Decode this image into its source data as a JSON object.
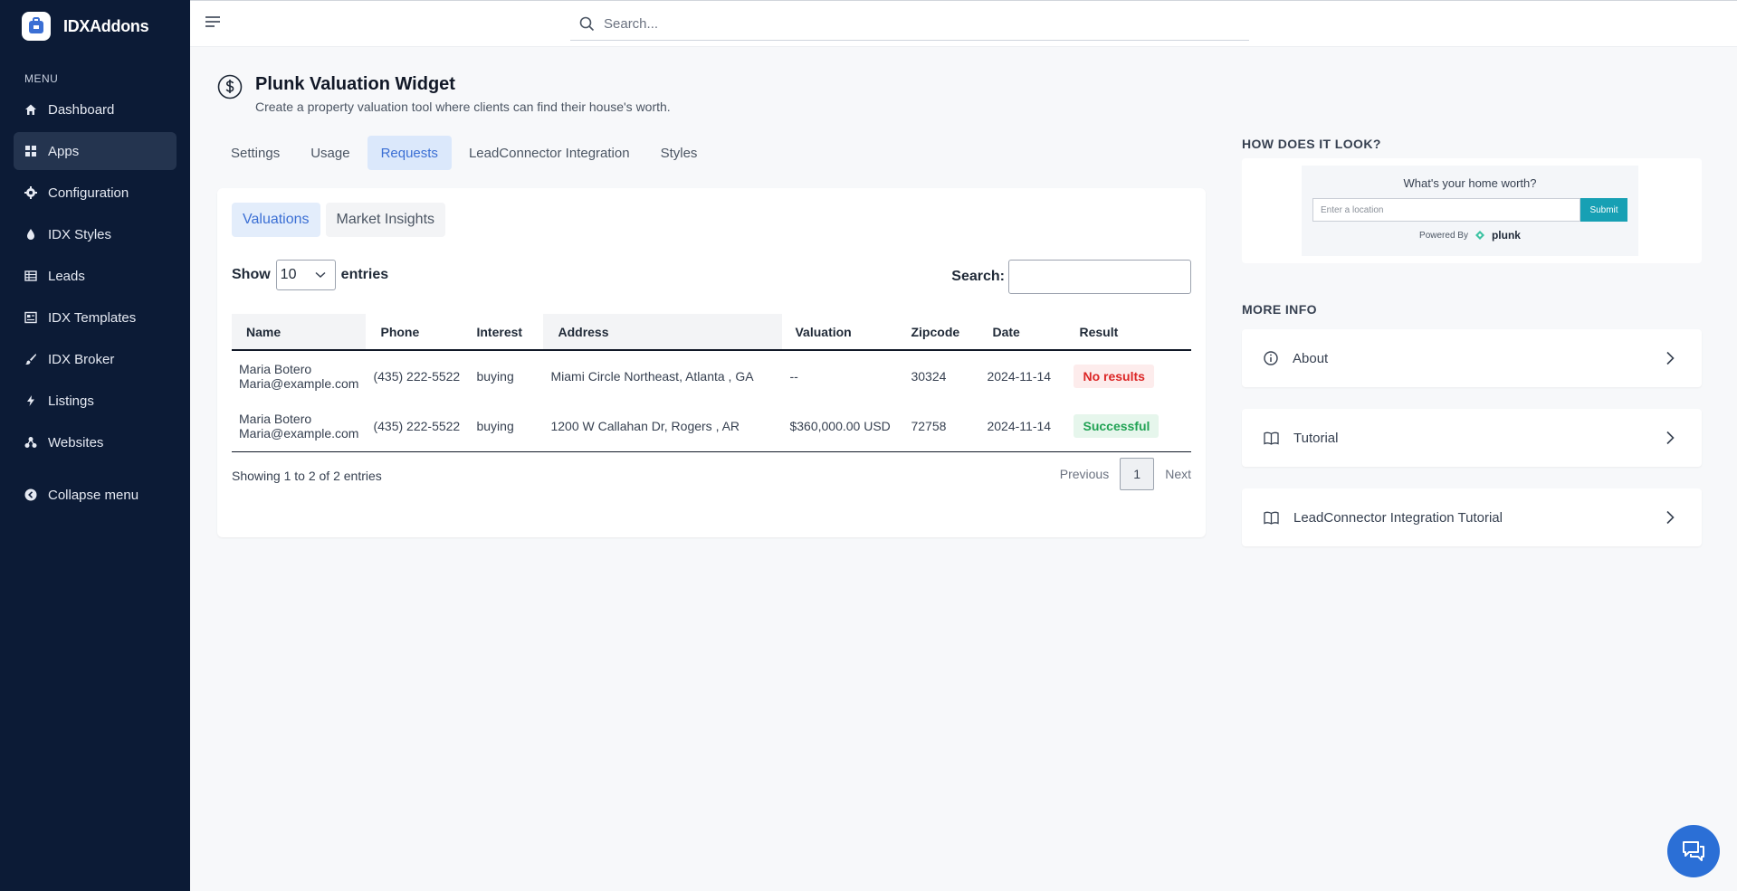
{
  "brand": {
    "name": "IDXAddons"
  },
  "sidebar": {
    "caption": "MENU",
    "items": [
      {
        "label": "Dashboard",
        "icon": "home-icon"
      },
      {
        "label": "Apps",
        "icon": "grid-icon",
        "active": true
      },
      {
        "label": "Configuration",
        "icon": "gear-icon"
      },
      {
        "label": "IDX Styles",
        "icon": "droplet-icon"
      },
      {
        "label": "Leads",
        "icon": "table-icon"
      },
      {
        "label": "IDX Templates",
        "icon": "template-icon"
      },
      {
        "label": "IDX Broker",
        "icon": "brush-icon"
      },
      {
        "label": "Listings",
        "icon": "bolt-icon"
      },
      {
        "label": "Websites",
        "icon": "network-icon"
      }
    ],
    "collapse_label": "Collapse menu"
  },
  "topbar": {
    "search_placeholder": "Search..."
  },
  "page": {
    "title": "Plunk Valuation Widget",
    "subtitle": "Create a property valuation tool where clients can find their house's worth."
  },
  "tabs": [
    "Settings",
    "Usage",
    "Requests",
    "LeadConnector Integration",
    "Styles"
  ],
  "active_tab": "Requests",
  "subtabs": [
    "Valuations",
    "Market Insights"
  ],
  "table": {
    "show_label": "Show",
    "entries_label": "entries",
    "page_length": "10",
    "search_label": "Search:",
    "columns": [
      "Name",
      "Phone",
      "Interest",
      "Address",
      "Valuation",
      "Zipcode",
      "Date",
      "Result"
    ],
    "rows": [
      {
        "name": "Maria Botero",
        "email": "Maria@example.com",
        "phone": "(435) 222-5522",
        "interest": "buying",
        "address": "Miami Circle Northeast, Atlanta , GA",
        "valuation": "--",
        "zipcode": "30324",
        "date": "2024-11-14",
        "result": "No results"
      },
      {
        "name": "Maria Botero",
        "email": "Maria@example.com",
        "phone": "(435) 222-5522",
        "interest": "buying",
        "address": "1200 W Callahan Dr, Rogers , AR",
        "valuation": "$360,000.00 USD",
        "zipcode": "72758",
        "date": "2024-11-14",
        "result": "Successful"
      }
    ],
    "info": "Showing 1 to 2 of 2 entries",
    "previous_label": "Previous",
    "current_page": "1",
    "next_label": "Next"
  },
  "preview": {
    "heading": "HOW DOES IT LOOK?",
    "widget_title": "What's your home worth?",
    "widget_placeholder": "Enter a location",
    "widget_button": "Submit",
    "powered_by": "Powered By",
    "powered_brand": "plunk"
  },
  "more_info": {
    "heading": "MORE INFO",
    "items": [
      "About",
      "Tutorial",
      "LeadConnector Integration Tutorial"
    ]
  },
  "colors": {
    "sidebar": "#0c1b36",
    "accent": "#3b6fd4",
    "success": "#22a355",
    "danger": "#dc2626",
    "chat": "#2b6fd6"
  }
}
